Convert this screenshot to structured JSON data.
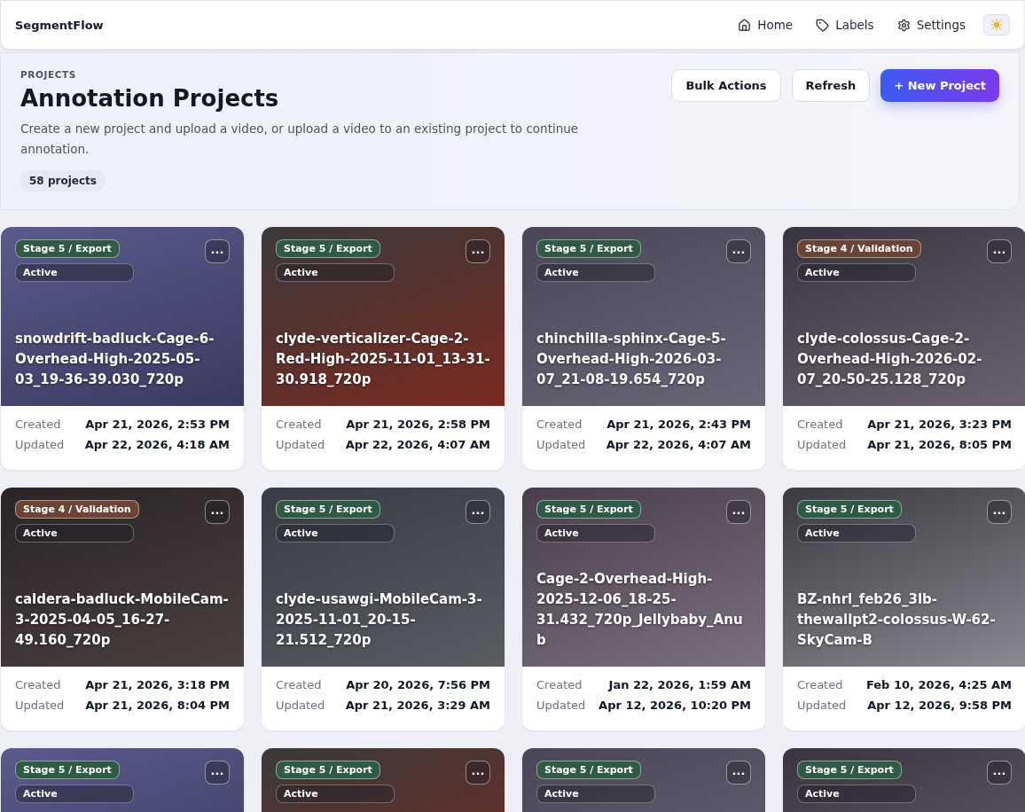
{
  "app": {
    "brand": "SegmentFlow"
  },
  "nav": [
    {
      "label": "Home"
    },
    {
      "label": "Labels"
    },
    {
      "label": "Settings"
    }
  ],
  "header": {
    "eyebrow": "PROJECTS",
    "title": "Annotation Projects",
    "description": "Create a new project and upload a video, or upload a video to an existing project to continue annotation.",
    "count": "58 projects",
    "actions": [
      {
        "label": "Bulk Actions",
        "kind": "secondary"
      },
      {
        "label": "Refresh",
        "kind": "secondary"
      },
      {
        "label": "+ New Project",
        "kind": "primary"
      }
    ]
  },
  "projects": [
    {
      "stage": "Stage 5 / Export",
      "color": "#2f5a45",
      "status": "Active",
      "menu": "...",
      "title": "snowdrift-badluck-Cage-6-Overhead-High-2025-05-03_19-36-39.030_720p",
      "created_label": "Created",
      "created": "Apr 21, 2026, 2:53 PM",
      "updated_label": "Updated",
      "updated": "Apr 22, 2026, 4:18 AM"
    },
    {
      "stage": "Stage 5 / Export",
      "color": "#2f5a45",
      "status": "Active",
      "menu": "...",
      "title": "clyde-verticalizer-Cage-2-Red-High-2025-11-01_13-31-30.918_720p",
      "created_label": "Created",
      "created": "Apr 21, 2026, 2:58 PM",
      "updated_label": "Updated",
      "updated": "Apr 22, 2026, 4:07 AM"
    },
    {
      "stage": "Stage 5 / Export",
      "color": "#2f5a45",
      "status": "Active",
      "menu": "...",
      "title": "chinchilla-sphinx-Cage-5-Overhead-High-2026-03-07_21-08-19.654_720p",
      "created_label": "Created",
      "created": "Apr 21, 2026, 2:43 PM",
      "updated_label": "Updated",
      "updated": "Apr 22, 2026, 4:07 AM"
    },
    {
      "stage": "Stage 4 / Validation",
      "color": "#6b4436",
      "status": "Active",
      "menu": "...",
      "title": "clyde-colossus-Cage-2-Overhead-High-2026-02-07_20-50-25.128_720p",
      "created_label": "Created",
      "created": "Apr 21, 2026, 3:23 PM",
      "updated_label": "Updated",
      "updated": "Apr 21, 2026, 8:05 PM"
    },
    {
      "stage": "Stage 4 / Validation",
      "color": "#6b4436",
      "status": "Active",
      "menu": "...",
      "title": "caldera-badluck-MobileCam-3-2025-04-05_16-27-49.160_720p",
      "created_label": "Created",
      "created": "Apr 21, 2026, 3:18 PM",
      "updated_label": "Updated",
      "updated": "Apr 21, 2026, 8:04 PM"
    },
    {
      "stage": "Stage 5 / Export",
      "color": "#2f5a45",
      "status": "Active",
      "menu": "...",
      "title": "clyde-usawgi-MobileCam-3-2025-11-01_20-15-21.512_720p",
      "created_label": "Created",
      "created": "Apr 20, 2026, 7:56 PM",
      "updated_label": "Updated",
      "updated": "Apr 21, 2026, 3:29 AM"
    },
    {
      "stage": "Stage 5 / Export",
      "color": "#2f5a45",
      "status": "Active",
      "menu": "...",
      "title": "Cage-2-Overhead-High-2025-12-06_18-25-31.432_720p_Jellybaby_Anub",
      "created_label": "Created",
      "created": "Jan 22, 2026, 1:59 AM",
      "updated_label": "Updated",
      "updated": "Apr 12, 2026, 10:20 PM"
    },
    {
      "stage": "Stage 5 / Export",
      "color": "#2f5a45",
      "status": "Active",
      "menu": "...",
      "title": "BZ-nhrl_feb26_3lb-thewallpt2-colossus-W-62-SkyCam-B",
      "created_label": "Created",
      "created": "Feb 10, 2026, 4:25 AM",
      "updated_label": "Updated",
      "updated": "Apr 12, 2026, 9:58 PM"
    },
    {
      "stage": "Stage 5 / Export",
      "color": "#2f5a45",
      "status": "Active",
      "menu": "..."
    },
    {
      "stage": "Stage 5 / Export",
      "color": "#2f5a45",
      "status": "Active",
      "menu": "..."
    },
    {
      "stage": "Stage 5 / Export",
      "color": "#2f5a45",
      "status": "Active",
      "menu": "..."
    },
    {
      "stage": "Stage 5 / Export",
      "color": "#2f5a45",
      "status": "Active",
      "menu": "..."
    }
  ]
}
